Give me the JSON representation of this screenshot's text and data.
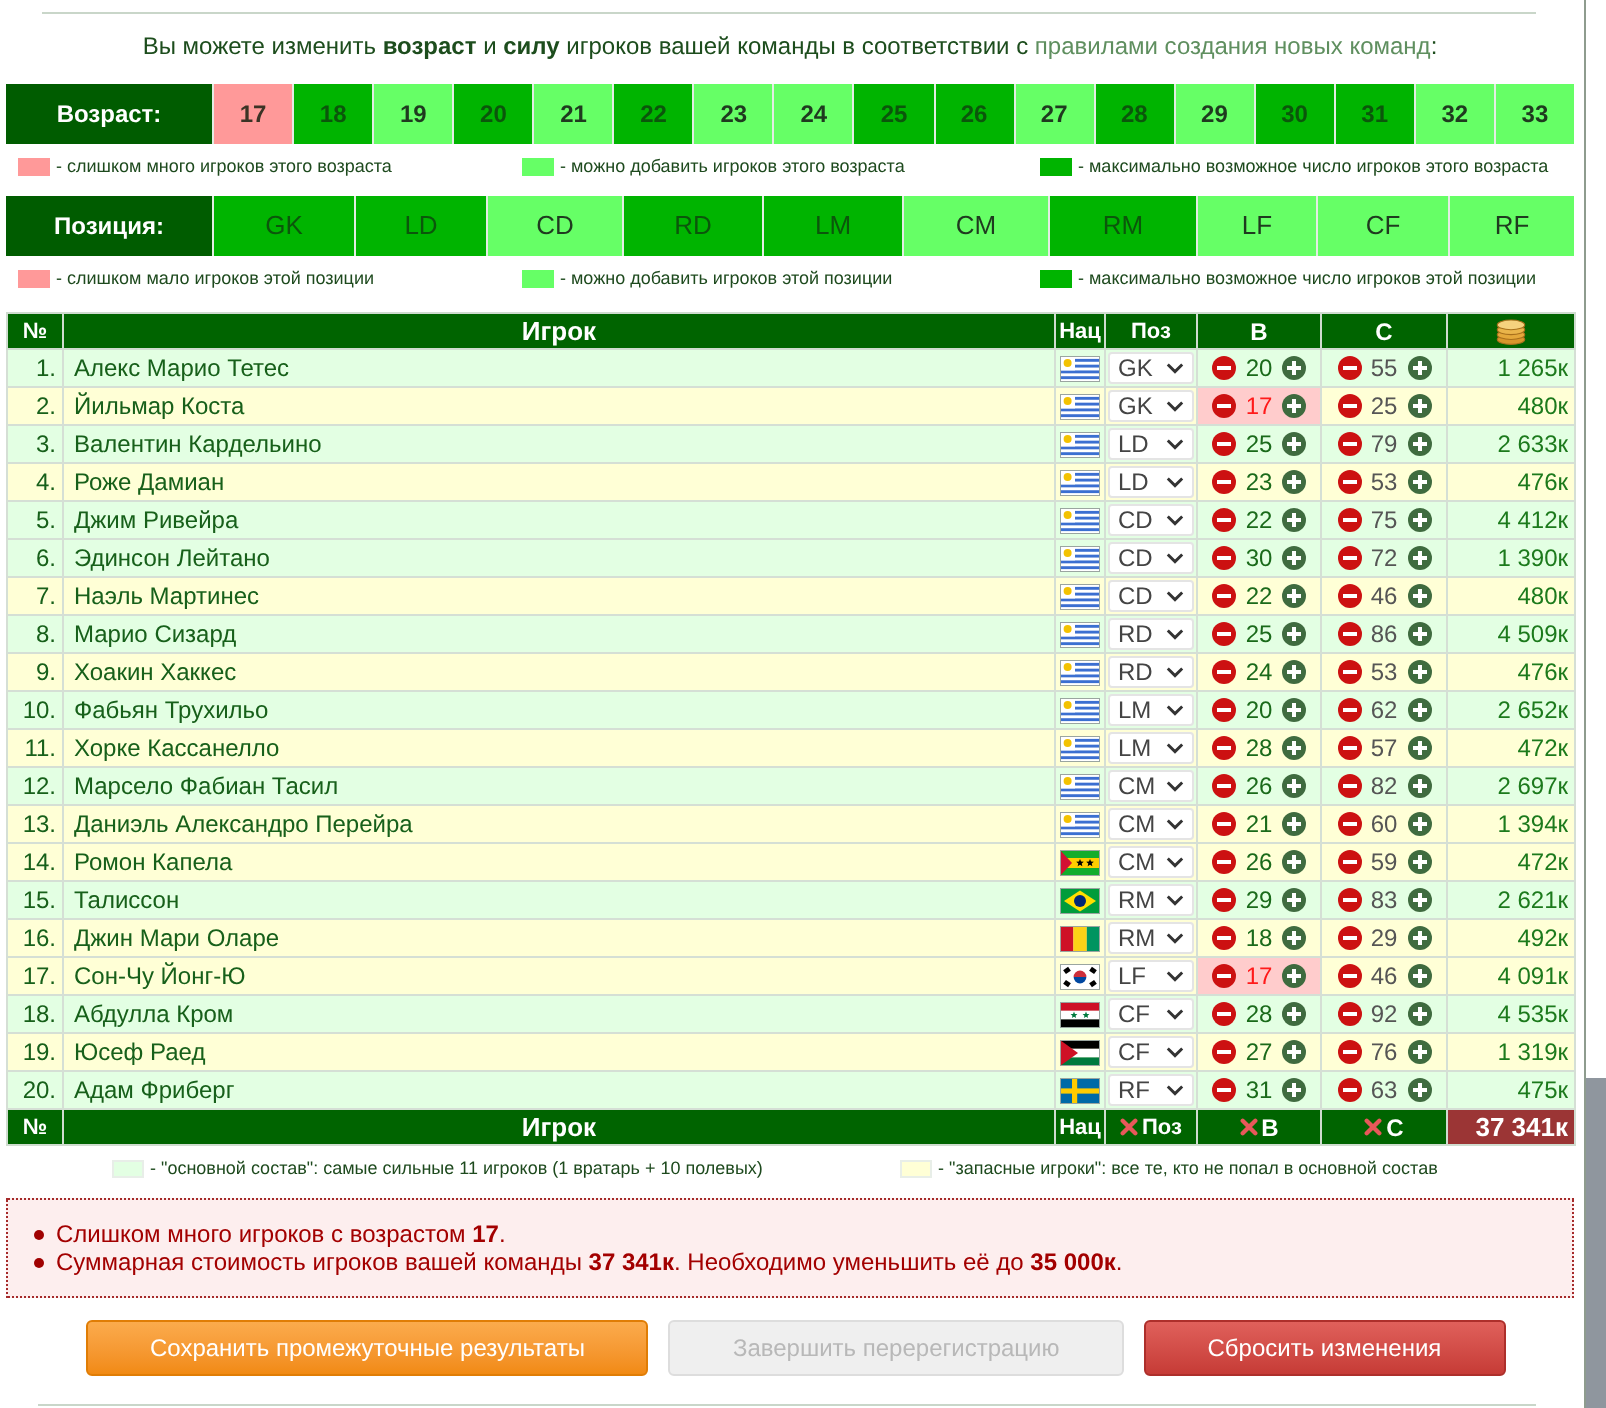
{
  "intro": {
    "text": "Вы можете изменить **возраст** и **силу** игроков вашей команды в соответствии с",
    "link": "правилами создания новых команд",
    "end": ":"
  },
  "age_filter": {
    "label": "Возраст:",
    "cells": [
      {
        "value": "17",
        "color": "#ff9999"
      },
      {
        "value": "18",
        "color": "#00b400"
      },
      {
        "value": "19",
        "color": "#66ff66"
      },
      {
        "value": "20",
        "color": "#00b400"
      },
      {
        "value": "21",
        "color": "#66ff66"
      },
      {
        "value": "22",
        "color": "#00b400"
      },
      {
        "value": "23",
        "color": "#66ff66"
      },
      {
        "value": "24",
        "color": "#66ff66"
      },
      {
        "value": "25",
        "color": "#00b400"
      },
      {
        "value": "26",
        "color": "#00b400"
      },
      {
        "value": "27",
        "color": "#66ff66"
      },
      {
        "value": "28",
        "color": "#00b400"
      },
      {
        "value": "29",
        "color": "#66ff66"
      },
      {
        "value": "30",
        "color": "#00b400"
      },
      {
        "value": "31",
        "color": "#00b400"
      },
      {
        "value": "32",
        "color": "#66ff66"
      },
      {
        "value": "33",
        "color": "#66ff66"
      }
    ],
    "legend": [
      {
        "color": "#ff9999",
        "text": "- слишком много игроков этого возраста"
      },
      {
        "color": "#66ff66",
        "text": "- можно добавить игроков этого возраста"
      },
      {
        "color": "#00b400",
        "text": "- максимально возможное число игроков этого возраста"
      }
    ]
  },
  "position_filter": {
    "label": "Позиция:",
    "cells": [
      {
        "value": "GK",
        "color": "#00b400"
      },
      {
        "value": "LD",
        "color": "#00b400"
      },
      {
        "value": "CD",
        "color": "#66ff66"
      },
      {
        "value": "RD",
        "color": "#00b400"
      },
      {
        "value": "LM",
        "color": "#00b400"
      },
      {
        "value": "CM",
        "color": "#66ff66"
      },
      {
        "value": "RM",
        "color": "#00b400"
      },
      {
        "value": "LF",
        "color": "#66ff66"
      },
      {
        "value": "CF",
        "color": "#66ff66"
      },
      {
        "value": "RF",
        "color": "#66ff66"
      }
    ],
    "legend": [
      {
        "color": "#ff9999",
        "text": "- слишком мало игроков этой позиции"
      },
      {
        "color": "#66ff66",
        "text": "- можно добавить игроков этой позиции"
      },
      {
        "color": "#00b400",
        "text": "- максимально возможное число игроков этой позиции"
      }
    ]
  },
  "table": {
    "columns": [
      "№",
      "Игрок",
      "Нац",
      "Поз",
      "В",
      "С"
    ],
    "rows": [
      {
        "number": "1.",
        "name": "Алекс Марио Тетес",
        "flag": {
          "kind": "uruguay"
        },
        "position": "GK",
        "age": "20",
        "age_warning": false,
        "strength": "55",
        "value": "1 265к",
        "color": "#e3ffe3"
      },
      {
        "number": "2.",
        "name": "Йильмар Коста",
        "flag": {
          "kind": "uruguay"
        },
        "position": "GK",
        "age": "17",
        "age_warning": true,
        "strength": "25",
        "value": "480к",
        "color": "#ffffd6"
      },
      {
        "number": "3.",
        "name": "Валентин Кардельино",
        "flag": {
          "kind": "uruguay"
        },
        "position": "LD",
        "age": "25",
        "age_warning": false,
        "strength": "79",
        "value": "2 633к",
        "color": "#e3ffe3"
      },
      {
        "number": "4.",
        "name": "Роже Дамиан",
        "flag": {
          "kind": "uruguay"
        },
        "position": "LD",
        "age": "23",
        "age_warning": false,
        "strength": "53",
        "value": "476к",
        "color": "#ffffd6"
      },
      {
        "number": "5.",
        "name": "Джим Ривейра",
        "flag": {
          "kind": "uruguay"
        },
        "position": "CD",
        "age": "22",
        "age_warning": false,
        "strength": "75",
        "value": "4 412к",
        "color": "#e3ffe3"
      },
      {
        "number": "6.",
        "name": "Эдинсон Лейтано",
        "flag": {
          "kind": "uruguay"
        },
        "position": "CD",
        "age": "30",
        "age_warning": false,
        "strength": "72",
        "value": "1 390к",
        "color": "#e3ffe3"
      },
      {
        "number": "7.",
        "name": "Наэль Мартинес",
        "flag": {
          "kind": "uruguay"
        },
        "position": "CD",
        "age": "22",
        "age_warning": false,
        "strength": "46",
        "value": "480к",
        "color": "#ffffd6"
      },
      {
        "number": "8.",
        "name": "Марио Сизард",
        "flag": {
          "kind": "uruguay"
        },
        "position": "RD",
        "age": "25",
        "age_warning": false,
        "strength": "86",
        "value": "4 509к",
        "color": "#e3ffe3"
      },
      {
        "number": "9.",
        "name": "Хоакин Хаккес",
        "flag": {
          "kind": "uruguay"
        },
        "position": "RD",
        "age": "24",
        "age_warning": false,
        "strength": "53",
        "value": "476к",
        "color": "#ffffd6"
      },
      {
        "number": "10.",
        "name": "Фабьян Трухильо",
        "flag": {
          "kind": "uruguay"
        },
        "position": "LM",
        "age": "20",
        "age_warning": false,
        "strength": "62",
        "value": "2 652к",
        "color": "#e3ffe3"
      },
      {
        "number": "11.",
        "name": "Хорке Кассанелло",
        "flag": {
          "kind": "uruguay"
        },
        "position": "LM",
        "age": "28",
        "age_warning": false,
        "strength": "57",
        "value": "472к",
        "color": "#ffffd6"
      },
      {
        "number": "12.",
        "name": "Марсело Фабиан Тасил",
        "flag": {
          "kind": "uruguay"
        },
        "position": "CM",
        "age": "26",
        "age_warning": false,
        "strength": "82",
        "value": "2 697к",
        "color": "#e3ffe3"
      },
      {
        "number": "13.",
        "name": "Даниэль Александро Перейра",
        "flag": {
          "kind": "uruguay"
        },
        "position": "CM",
        "age": "21",
        "age_warning": false,
        "strength": "60",
        "value": "1 394к",
        "color": "#ffffd6"
      },
      {
        "number": "14.",
        "name": "Ромон Капела",
        "flag": {
          "kind": "sao_tome"
        },
        "position": "CM",
        "age": "26",
        "age_warning": false,
        "strength": "59",
        "value": "472к",
        "color": "#ffffd6"
      },
      {
        "number": "15.",
        "name": "Талиссон",
        "flag": {
          "kind": "brazil"
        },
        "position": "RM",
        "age": "29",
        "age_warning": false,
        "strength": "83",
        "value": "2 621к",
        "color": "#e3ffe3"
      },
      {
        "number": "16.",
        "name": "Джин Мари Оларе",
        "flag": {
          "kind": "guinea"
        },
        "position": "RM",
        "age": "18",
        "age_warning": false,
        "strength": "29",
        "value": "492к",
        "color": "#ffffd6"
      },
      {
        "number": "17.",
        "name": "Сон-Чу Йонг-Ю",
        "flag": {
          "kind": "korea"
        },
        "position": "LF",
        "age": "17",
        "age_warning": true,
        "strength": "46",
        "value": "4 091к",
        "color": "#ffffd6"
      },
      {
        "number": "18.",
        "name": "Абдулла Кром",
        "flag": {
          "kind": "syria"
        },
        "position": "CF",
        "age": "28",
        "age_warning": false,
        "strength": "92",
        "value": "4 535к",
        "color": "#e3ffe3"
      },
      {
        "number": "19.",
        "name": "Юсеф Раед",
        "flag": {
          "kind": "jordan"
        },
        "position": "CF",
        "age": "27",
        "age_warning": false,
        "strength": "76",
        "value": "1 319к",
        "color": "#ffffd6"
      },
      {
        "number": "20.",
        "name": "Адам Фриберг",
        "flag": {
          "kind": "sweden"
        },
        "position": "RF",
        "age": "31",
        "age_warning": false,
        "strength": "63",
        "value": "475к",
        "color": "#e3ffe3"
      }
    ],
    "footer": {
      "number": "№",
      "player": "Игрок",
      "nation": "Нац",
      "reset_position": "Поз",
      "reset_age": "В",
      "reset_strength": "С",
      "total": "37 341к"
    }
  },
  "squad_legend": [
    {
      "color": "#e3ffe3",
      "text": "- \"основной состав\": самые сильные 11 игроков (1 вратарь + 10 полевых)"
    },
    {
      "color": "#ffffd6",
      "text": "- \"запасные игроки\": все те, кто не попал в основной состав"
    }
  ],
  "errors": [
    "Слишком много игроков с возрастом **17**.",
    "Суммарная стоимость игроков вашей команды **37 341к**. Необходимо уменьшить её до **35 000к**."
  ],
  "buttons": [
    {
      "label": "Сохранить промежуточные результаты",
      "kind": "save",
      "disabled": false
    },
    {
      "label": "Завершить перерегистрацию",
      "kind": "finish",
      "disabled": true
    },
    {
      "label": "Сбросить изменения",
      "kind": "reset",
      "disabled": false
    }
  ]
}
